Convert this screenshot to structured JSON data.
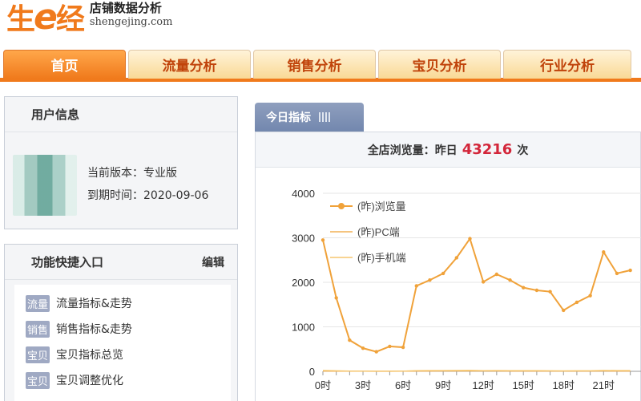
{
  "logo": {
    "mark_a": "生",
    "mark_e": "e",
    "mark_b": "经",
    "title": "店铺数据分析",
    "domain": "shengejing.com"
  },
  "nav": {
    "tabs": [
      "首页",
      "流量分析",
      "销售分析",
      "宝贝分析",
      "行业分析"
    ],
    "active": 0
  },
  "user_panel": {
    "title": "用户信息",
    "version": "当前版本：专业版",
    "expiry": "到期时间：2020-09-06"
  },
  "fn_panel": {
    "title": "功能快捷入口",
    "edit": "编辑",
    "items": [
      {
        "tag": "流量",
        "label": "流量指标&走势"
      },
      {
        "tag": "销售",
        "label": "销售指标&走势"
      },
      {
        "tag": "宝贝",
        "label": "宝贝指标总览"
      },
      {
        "tag": "宝贝",
        "label": "宝贝调整优化"
      }
    ]
  },
  "content": {
    "tab": "今日指标",
    "summary_label": "全店浏览量：",
    "summary_day": "昨日",
    "summary_value": "43216",
    "summary_unit": "次"
  },
  "colors": {
    "accent": "#f07a1c",
    "line": "#f0a23a",
    "value": "#d3263a"
  },
  "chart_data": {
    "type": "line",
    "x": [
      "0时",
      "1时",
      "2时",
      "3时",
      "4时",
      "5时",
      "6时",
      "7时",
      "8时",
      "9时",
      "10时",
      "11时",
      "12时",
      "13时",
      "14时",
      "15时",
      "16时",
      "17时",
      "18时",
      "19时",
      "20时",
      "21时",
      "22时",
      "23时"
    ],
    "xticks": [
      "0时",
      "3时",
      "6时",
      "9时",
      "12时",
      "15时",
      "18时",
      "21时"
    ],
    "ylim": [
      0,
      4000
    ],
    "yticks": [
      0,
      1000,
      2000,
      3000,
      4000
    ],
    "legend_position": "top-left",
    "series": [
      {
        "name": "(昨)浏览量",
        "values": [
          2950,
          1650,
          700,
          520,
          440,
          560,
          540,
          1920,
          2050,
          2200,
          2550,
          2980,
          2010,
          2180,
          2050,
          1880,
          1820,
          1790,
          1370,
          1550,
          1700,
          2680,
          2200,
          2270
        ]
      },
      {
        "name": "(昨)PC端",
        "values": [
          5,
          4,
          3,
          3,
          2,
          2,
          3,
          5,
          6,
          7,
          7,
          8,
          7,
          7,
          6,
          6,
          6,
          6,
          5,
          5,
          6,
          7,
          6,
          6
        ]
      },
      {
        "name": "(昨)手机端",
        "values": [
          20,
          12,
          6,
          4,
          3,
          4,
          4,
          14,
          16,
          17,
          19,
          22,
          15,
          16,
          15,
          14,
          14,
          13,
          10,
          12,
          13,
          20,
          16,
          17
        ]
      }
    ]
  }
}
